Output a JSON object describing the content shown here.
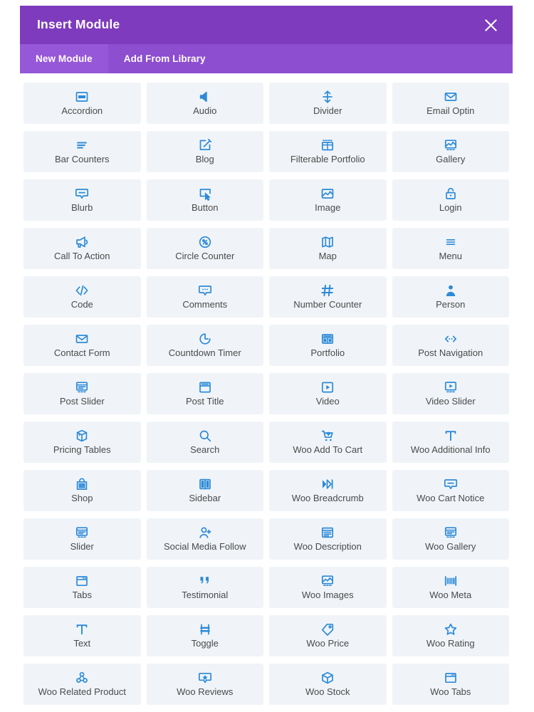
{
  "header": {
    "title": "Insert Module",
    "close_label": "×",
    "close_icon": "close-icon",
    "bg_color": "#7e3bbd"
  },
  "tabs": {
    "bg_color": "#8d4ed0",
    "active_bg_color": "#9657d8",
    "items": [
      {
        "label": "New Module",
        "active": true
      },
      {
        "label": "Add From Library",
        "active": false
      }
    ]
  },
  "grid": {
    "card_bg": "#f0f4f8",
    "icon_color": "#2d8ad8",
    "label_color": "#4a4a4a",
    "columns": 4,
    "modules": [
      {
        "label": "Accordion",
        "icon": "accordion-icon"
      },
      {
        "label": "Audio",
        "icon": "speaker-icon"
      },
      {
        "label": "Divider",
        "icon": "divider-arrows-icon"
      },
      {
        "label": "Email Optin",
        "icon": "envelope-icon"
      },
      {
        "label": "Bar Counters",
        "icon": "bars-icon"
      },
      {
        "label": "Blog",
        "icon": "pencil-square-icon"
      },
      {
        "label": "Filterable Portfolio",
        "icon": "grid-filter-icon"
      },
      {
        "label": "Gallery",
        "icon": "images-icon"
      },
      {
        "label": "Blurb",
        "icon": "speech-bubble-icon"
      },
      {
        "label": "Button",
        "icon": "cursor-box-icon"
      },
      {
        "label": "Image",
        "icon": "picture-icon"
      },
      {
        "label": "Login",
        "icon": "lock-icon"
      },
      {
        "label": "Call To Action",
        "icon": "megaphone-icon"
      },
      {
        "label": "Circle Counter",
        "icon": "circle-percent-icon"
      },
      {
        "label": "Map",
        "icon": "map-icon"
      },
      {
        "label": "Menu",
        "icon": "hamburger-icon"
      },
      {
        "label": "Code",
        "icon": "code-brackets-icon"
      },
      {
        "label": "Comments",
        "icon": "comment-dots-icon"
      },
      {
        "label": "Number Counter",
        "icon": "hash-icon"
      },
      {
        "label": "Person",
        "icon": "person-icon"
      },
      {
        "label": "Contact Form",
        "icon": "envelope-icon"
      },
      {
        "label": "Countdown Timer",
        "icon": "clock-icon"
      },
      {
        "label": "Portfolio",
        "icon": "grid-squares-icon"
      },
      {
        "label": "Post Navigation",
        "icon": "arrows-dots-icon"
      },
      {
        "label": "Post Slider",
        "icon": "slider-box-icon"
      },
      {
        "label": "Post Title",
        "icon": "title-box-icon"
      },
      {
        "label": "Video",
        "icon": "play-box-icon"
      },
      {
        "label": "Video Slider",
        "icon": "play-slider-icon"
      },
      {
        "label": "Pricing Tables",
        "icon": "cube-box-icon"
      },
      {
        "label": "Search",
        "icon": "magnifier-icon"
      },
      {
        "label": "Woo Add To Cart",
        "icon": "cart-plus-icon"
      },
      {
        "label": "Woo Additional Info",
        "icon": "text-t-icon"
      },
      {
        "label": "Shop",
        "icon": "shopping-bag-icon"
      },
      {
        "label": "Sidebar",
        "icon": "sidebar-columns-icon"
      },
      {
        "label": "Woo Breadcrumb",
        "icon": "breadcrumb-icon"
      },
      {
        "label": "Woo Cart Notice",
        "icon": "speech-bubble-icon"
      },
      {
        "label": "Slider",
        "icon": "slider-box-icon"
      },
      {
        "label": "Social Media Follow",
        "icon": "person-plus-icon"
      },
      {
        "label": "Woo Description",
        "icon": "lines-box-icon"
      },
      {
        "label": "Woo Gallery",
        "icon": "slider-box-icon"
      },
      {
        "label": "Tabs",
        "icon": "tabs-box-icon"
      },
      {
        "label": "Testimonial",
        "icon": "quote-icon"
      },
      {
        "label": "Woo Images",
        "icon": "images-icon"
      },
      {
        "label": "Woo Meta",
        "icon": "barcode-icon"
      },
      {
        "label": "Text",
        "icon": "text-t-icon"
      },
      {
        "label": "Toggle",
        "icon": "toggle-icon"
      },
      {
        "label": "Woo Price",
        "icon": "price-tag-icon"
      },
      {
        "label": "Woo Rating",
        "icon": "star-icon"
      },
      {
        "label": "Woo Related Product",
        "icon": "related-nodes-icon"
      },
      {
        "label": "Woo Reviews",
        "icon": "review-bubble-icon"
      },
      {
        "label": "Woo Stock",
        "icon": "cube-icon"
      },
      {
        "label": "Woo Tabs",
        "icon": "tabs-box-icon"
      }
    ]
  }
}
